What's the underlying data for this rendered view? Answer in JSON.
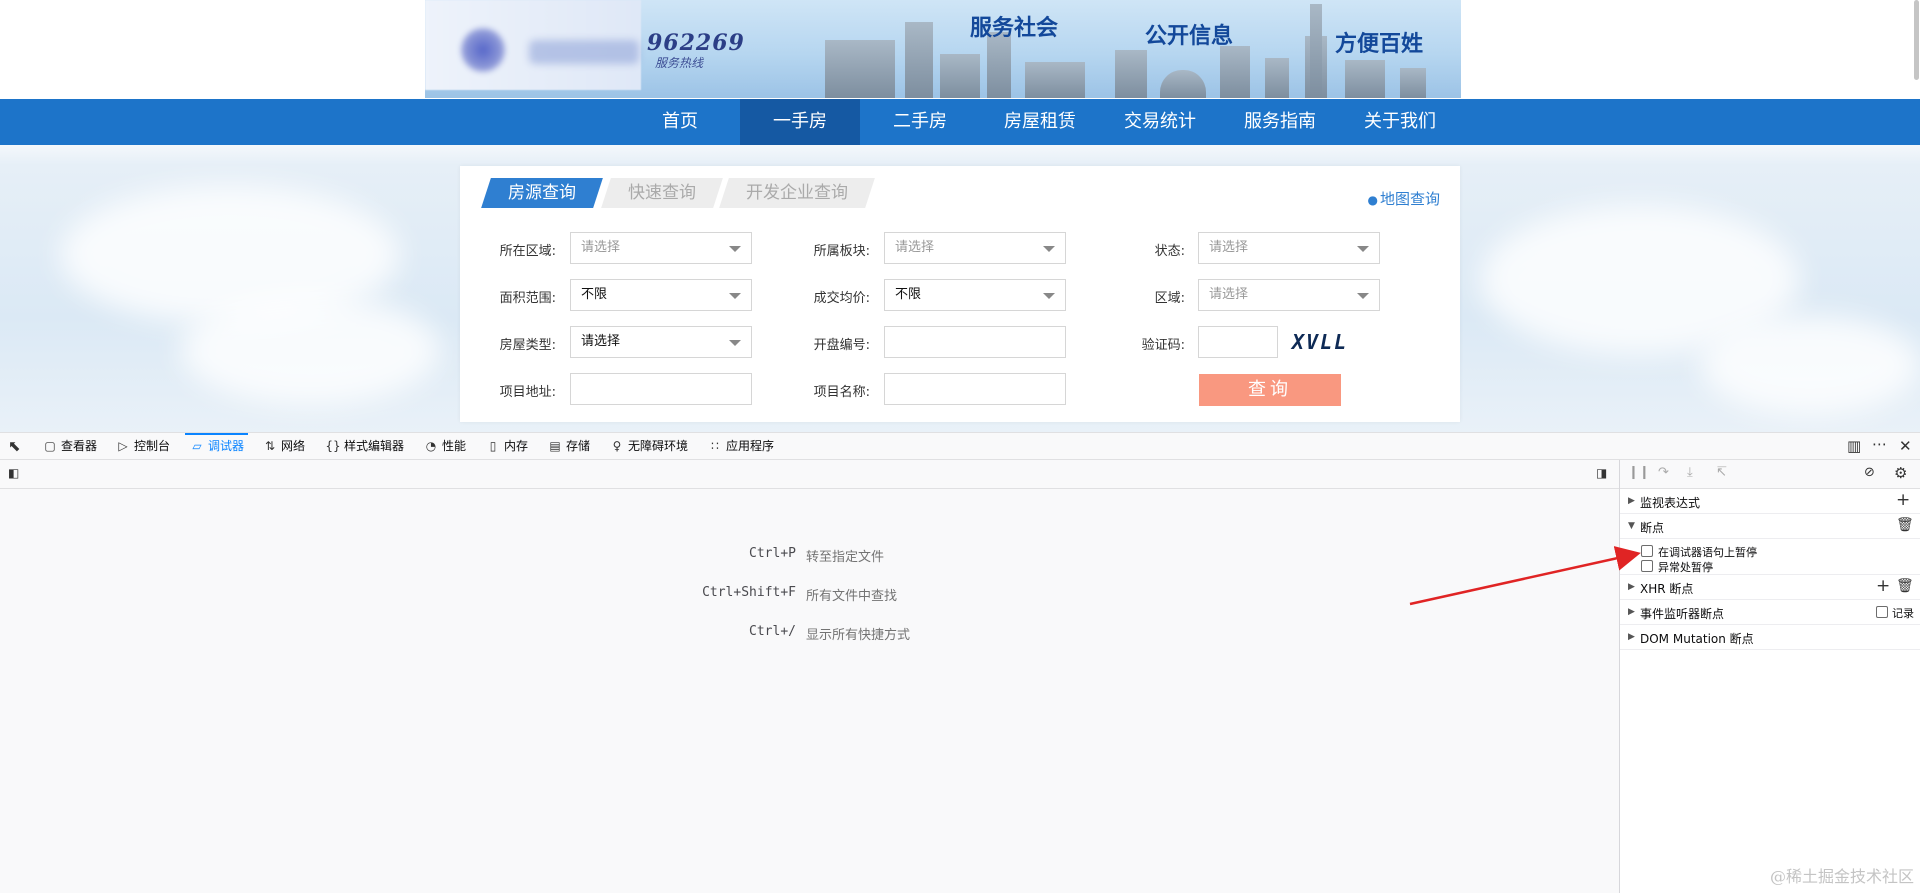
{
  "banner": {
    "hotline_number": "962269",
    "hotline_sub": "服务热线",
    "slogans": [
      "服务社会",
      "公开信息",
      "方便百姓"
    ]
  },
  "nav": {
    "items": [
      "首页",
      "一手房",
      "二手房",
      "房屋租赁",
      "交易统计",
      "服务指南",
      "关于我们"
    ],
    "active": "一手房"
  },
  "search": {
    "tabs": [
      "房源查询",
      "快速查询",
      "开发企业查询"
    ],
    "active_tab": "房源查询",
    "map_link": "地图查询",
    "fields": {
      "district_label": "所在区域:",
      "district_value": "请选择",
      "block_label": "所属板块:",
      "block_value": "请选择",
      "status_label": "状态:",
      "status_value": "请选择",
      "area_label": "面积范围:",
      "area_value": "不限",
      "price_label": "成交均价:",
      "price_value": "不限",
      "region_label": "区域:",
      "region_value": "请选择",
      "type_label": "房屋类型:",
      "type_value": "请选择",
      "license_label": "开盘编号:",
      "license_value": "",
      "captcha_label": "验证码:",
      "captcha_value": "",
      "captcha_image_text": "XVLL",
      "address_label": "项目地址:",
      "address_value": "",
      "project_label": "项目名称:",
      "project_value": ""
    },
    "submit_label": "查询"
  },
  "devtools": {
    "tabs": [
      {
        "label": "查看器",
        "icon": "inspector-icon"
      },
      {
        "label": "控制台",
        "icon": "console-icon"
      },
      {
        "label": "调试器",
        "icon": "debugger-icon"
      },
      {
        "label": "网络",
        "icon": "network-icon"
      },
      {
        "label": "样式编辑器",
        "icon": "style-editor-icon"
      },
      {
        "label": "性能",
        "icon": "performance-icon"
      },
      {
        "label": "内存",
        "icon": "memory-icon"
      },
      {
        "label": "存储",
        "icon": "storage-icon"
      },
      {
        "label": "无障碍环境",
        "icon": "accessibility-icon"
      },
      {
        "label": "应用程序",
        "icon": "application-icon"
      }
    ],
    "active_tab": "调试器",
    "shortcuts": [
      {
        "key": "Ctrl+P",
        "desc": "转至指定文件"
      },
      {
        "key": "Ctrl+Shift+F",
        "desc": "所有文件中查找"
      },
      {
        "key": "Ctrl+/",
        "desc": "显示所有快捷方式"
      }
    ],
    "sidebar": {
      "watch": "监视表达式",
      "breakpoints": "断点",
      "pause_on_debugger": "在调试器语句上暂停",
      "pause_on_exceptions": "异常处暂停",
      "xhr": "XHR 断点",
      "event_listeners": "事件监听器断点",
      "log": "记录",
      "dom_mutation": "DOM Mutation 断点"
    }
  },
  "watermark": "@稀土掘金技术社区",
  "colors": {
    "nav_bg": "#1d74c9",
    "nav_active": "#1559a3",
    "tab_active": "#2f7fd1",
    "query_button": "#f99880",
    "devtools_accent": "#0a84ff",
    "annotation_arrow": "#e02424"
  }
}
